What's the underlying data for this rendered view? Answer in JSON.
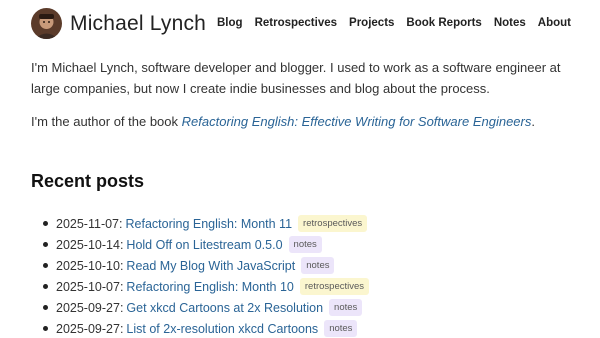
{
  "site": {
    "title": "Michael Lynch"
  },
  "nav": {
    "items": [
      {
        "label": "Blog"
      },
      {
        "label": "Retrospectives"
      },
      {
        "label": "Projects"
      },
      {
        "label": "Book Reports"
      },
      {
        "label": "Notes"
      },
      {
        "label": "About"
      }
    ]
  },
  "intro": {
    "paragraph1": "I'm Michael Lynch, software developer and blogger. I used to work as a software engineer at large companies, but now I create indie businesses and blog about the process.",
    "paragraph2_prefix": "I'm the author of the book ",
    "book_title": "Refactoring English: Effective Writing for Software Engineers",
    "paragraph2_suffix": "."
  },
  "recent": {
    "heading": "Recent posts",
    "posts": [
      {
        "date": "2025-11-07:",
        "title": "Refactoring English: Month 11",
        "tag": "retrospectives"
      },
      {
        "date": "2025-10-14:",
        "title": "Hold Off on Litestream 0.5.0",
        "tag": "notes"
      },
      {
        "date": "2025-10-10:",
        "title": "Read My Blog With JavaScript",
        "tag": "notes"
      },
      {
        "date": "2025-10-07:",
        "title": "Refactoring English: Month 10",
        "tag": "retrospectives"
      },
      {
        "date": "2025-09-27:",
        "title": "Get xkcd Cartoons at 2x Resolution",
        "tag": "notes"
      },
      {
        "date": "2025-09-27:",
        "title": "List of 2x-resolution xkcd Cartoons",
        "tag": "notes"
      }
    ]
  },
  "colors": {
    "link": "#2a6496",
    "retrospectives_tag_bg": "#fbf6cf",
    "notes_tag_bg": "#ece5fa"
  }
}
